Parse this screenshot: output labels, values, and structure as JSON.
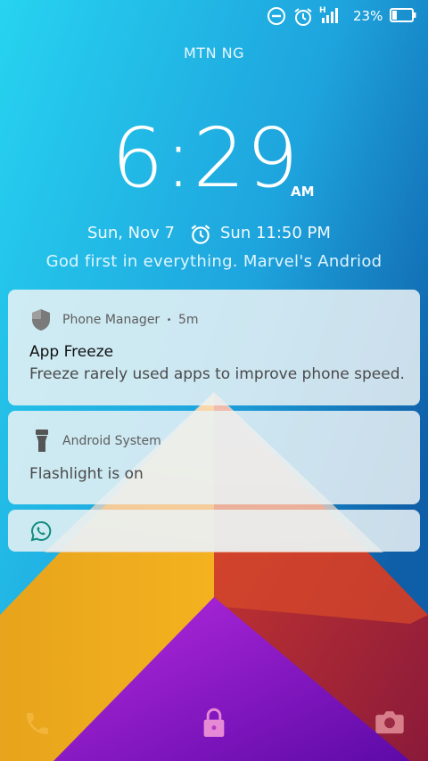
{
  "status_bar": {
    "icons": [
      "do-not-disturb-icon",
      "alarm-icon",
      "signal-h-icon",
      "battery-icon"
    ],
    "network_type": "H",
    "battery_percent": "23%",
    "battery_level": 0.23
  },
  "carrier": "MTN NG",
  "clock": {
    "time": "6:29",
    "ampm": "AM"
  },
  "date": "Sun, Nov 7",
  "next_alarm": "Sun 11:50 PM",
  "owner_info": "God first in everything. Marvel's Andriod",
  "notifications": [
    {
      "app_icon": "shield-icon",
      "app_name": "Phone Manager",
      "separator": "•",
      "time": "5m",
      "title": "App Freeze",
      "text": "Freeze rarely used apps to improve phone speed."
    },
    {
      "app_icon": "flashlight-icon",
      "app_name": "Android System",
      "text": "Flashlight is on"
    },
    {
      "app_icon": "whatsapp-icon"
    }
  ],
  "bottom_shortcuts": [
    "phone-icon",
    "lock-icon",
    "camera-icon"
  ],
  "colors": {
    "accent_green": "#128c7e",
    "phone_icon": "#f2b53a",
    "lock_icon": "#e78ad6",
    "camera_icon": "#d87e8a"
  }
}
